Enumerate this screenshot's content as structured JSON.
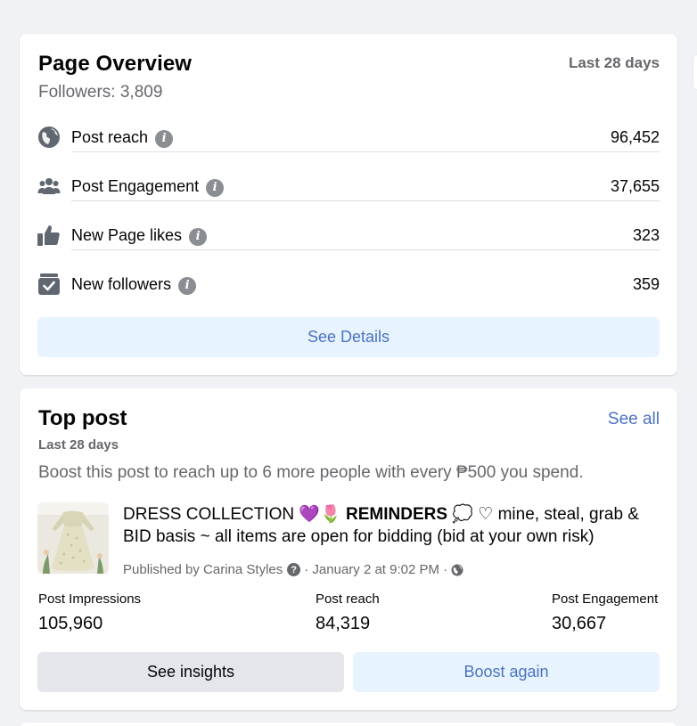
{
  "page_overview": {
    "title": "Page Overview",
    "period": "Last 28 days",
    "followers": "Followers: 3,809",
    "metrics": [
      {
        "label": "Post reach",
        "value": "96,452",
        "icon": "globe-icon"
      },
      {
        "label": "Post Engagement",
        "value": "37,655",
        "icon": "people-icon"
      },
      {
        "label": "New Page likes",
        "value": "323",
        "icon": "thumbs-up-icon"
      },
      {
        "label": "New followers",
        "value": "359",
        "icon": "follower-check-icon"
      }
    ],
    "info_glyph": "i",
    "see_details_label": "See Details"
  },
  "top_post": {
    "title": "Top post",
    "see_all_label": "See all",
    "period": "Last 28 days",
    "boost_hint": "Boost this post to reach up to 6 more people with every ₱500 you spend.",
    "post": {
      "text_part1": "DRESS COLLECTION 💜🌷 ",
      "text_bold": "REMINDERS",
      "text_part2": " 💭 ♡ mine, steal, grab & BID basis ~ all items are open for bidding (bid at your own risk)",
      "published_by": "Published by Carina Styles",
      "help_glyph": "?",
      "date": "· January 2 at 9:02 PM ·"
    },
    "stats": [
      {
        "label": "Post Impressions",
        "value": "105,960"
      },
      {
        "label": "Post reach",
        "value": "84,319"
      },
      {
        "label": "Post Engagement",
        "value": "30,667"
      }
    ],
    "see_insights_label": "See insights",
    "boost_again_label": "Boost again"
  },
  "colors": {
    "accent_blue": "#4b72c2",
    "light_blue_bg": "#e7f3ff",
    "secondary_text": "#65676b",
    "page_bg": "#f0f2f5"
  }
}
